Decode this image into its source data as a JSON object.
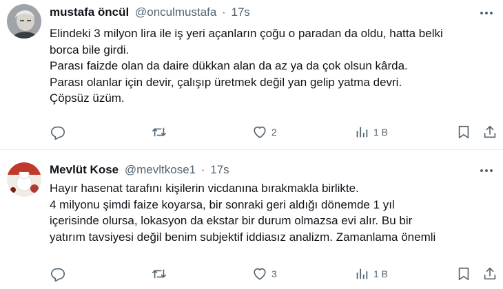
{
  "tweets": [
    {
      "author": {
        "name": "mustafa öncül",
        "handle": "@onculmustafa",
        "separator": "·",
        "time": "17s"
      },
      "lines": [
        "Elindeki 3 milyon lira ile iş yeri açanların çoğu o paradan da oldu, hatta belki",
        "borca bile girdi.",
        "Parası faizde olan da daire dükkan alan da az ya da çok olsun kârda.",
        "Parası olanlar için devir, çalışıp üretmek değil yan gelip yatma devri.",
        "Çöpsüz üzüm."
      ],
      "metrics": {
        "replies": "",
        "reposts": "",
        "likes": "2",
        "views": "1 B"
      }
    },
    {
      "author": {
        "name": "Mevlüt Kose",
        "handle": "@mevltkose1",
        "separator": "·",
        "time": "17s"
      },
      "lines": [
        "Hayır hasenat tarafını kişilerin vicdanına bırakmakla birlikte.",
        "4 milyonu şimdi faize koyarsa, bir sonraki geri aldığı dönemde 1 yıl",
        "içerisinde olursa, lokasyon da ekstar bir durum olmazsa evi alır. Bu bir",
        "yatırım tavsiyesi değil benim subjektif iddiasız analizm. Zamanlama önemli"
      ],
      "metrics": {
        "replies": "",
        "reposts": "",
        "likes": "3",
        "views": "1 B"
      }
    }
  ],
  "icons": {
    "reply": "reply-icon",
    "repost": "repost-icon",
    "like": "heart-icon",
    "views": "views-chart-icon",
    "bookmark": "bookmark-icon",
    "share": "share-icon",
    "more": "more-dots-icon"
  },
  "colors": {
    "text": "#0f1419",
    "secondary": "#536471",
    "divider": "#e6ecf0"
  }
}
